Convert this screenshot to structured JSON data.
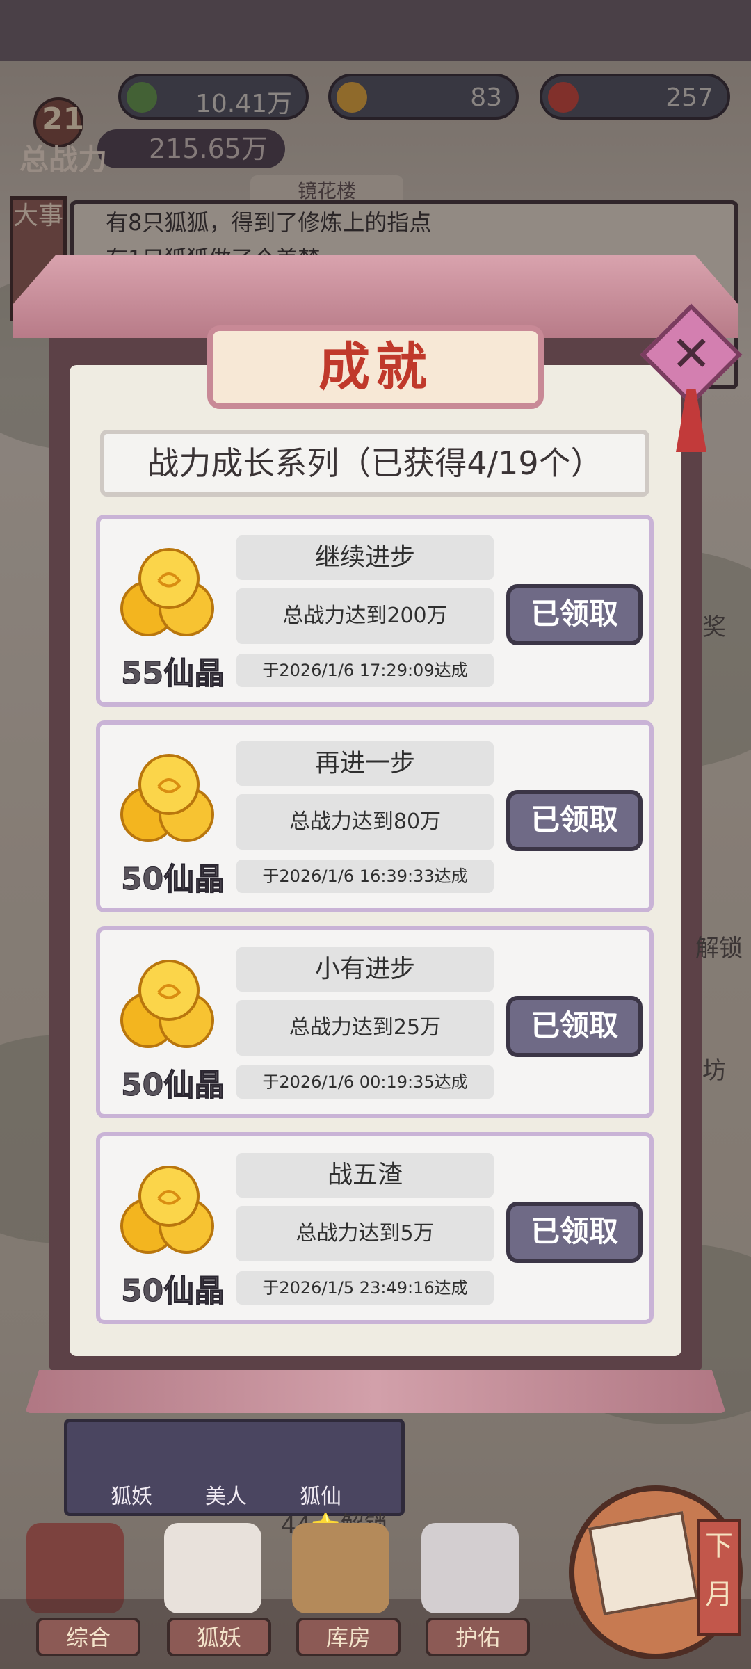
{
  "hud": {
    "jade_value": "10.41万",
    "gold_value": "83",
    "fruit_value": "257",
    "level": "21",
    "power_label": "总战力",
    "power_value": "215.65万",
    "location_title": "镜花楼",
    "side_label": "大事",
    "news": [
      "有8只狐狐，得到了修炼上的指点",
      "有1只狐狐做了个美梦"
    ]
  },
  "modal": {
    "title": "成就",
    "close_icon": "close-x-icon",
    "series_title": "战力成长系列（已获得4/19个）",
    "achievements": [
      {
        "name": "继续进步",
        "condition": "总战力达到200万",
        "time": "于2026/1/6  17:29:09达成",
        "reward": "55仙晶",
        "button": "已领取"
      },
      {
        "name": "再进一步",
        "condition": "总战力达到80万",
        "time": "于2026/1/6  16:39:33达成",
        "reward": "50仙晶",
        "button": "已领取"
      },
      {
        "name": "小有进步",
        "condition": "总战力达到25万",
        "time": "于2026/1/6  00:19:35达成",
        "reward": "50仙晶",
        "button": "已领取"
      },
      {
        "name": "战五渣",
        "condition": "总战力达到5万",
        "time": "于2026/1/5  23:49:16达成",
        "reward": "50仙晶",
        "button": "已领取"
      }
    ]
  },
  "background": {
    "right_unlock": "解锁",
    "right_fang": "坊",
    "right_jiang": "奖"
  },
  "subnav": {
    "items": [
      "狐妖",
      "美人",
      "狐仙"
    ],
    "unlock_text": "44⭐解锁"
  },
  "nav": {
    "items": [
      "综合",
      "狐妖",
      "库房",
      "护佑"
    ],
    "month_label": "下月"
  },
  "colors": {
    "accent_red": "#c0392b",
    "button_purple": "#6f6a86",
    "card_border": "#c9b3d6"
  }
}
